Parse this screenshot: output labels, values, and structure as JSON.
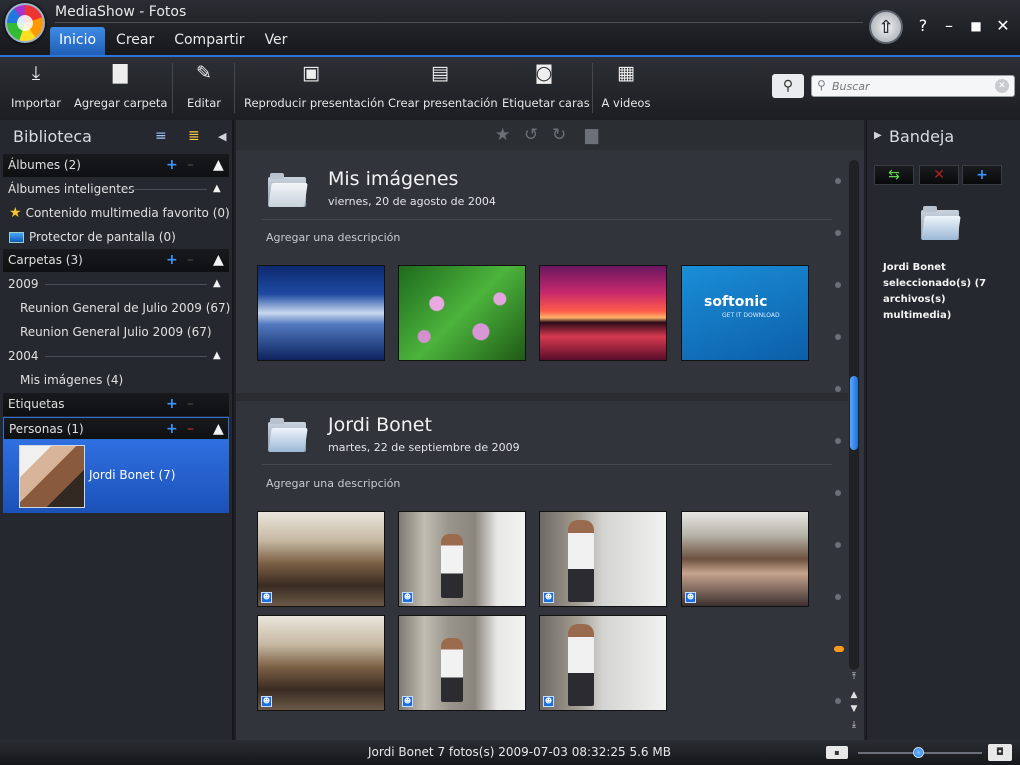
{
  "app": {
    "title": "MediaShow - Fotos"
  },
  "menu": [
    {
      "label": "Inicio",
      "active": true
    },
    {
      "label": "Crear"
    },
    {
      "label": "Compartir"
    },
    {
      "label": "Ver"
    }
  ],
  "window_controls": {
    "help": "?",
    "minimize": "–",
    "maximize": "■",
    "close": "✕"
  },
  "toolbar": {
    "items": [
      {
        "label": "Importar",
        "icon": "import-icon"
      },
      {
        "label": "Agregar carpeta",
        "icon": "add-folder-icon"
      },
      {
        "label": "Editar",
        "icon": "edit-brush-icon"
      },
      {
        "label": "Reproducir presentación",
        "icon": "play-slideshow-icon"
      },
      {
        "label": "Crear presentación",
        "icon": "create-slideshow-icon"
      },
      {
        "label": "Etiquetar caras",
        "icon": "tag-faces-icon"
      },
      {
        "label": "A videos",
        "icon": "to-video-icon"
      }
    ]
  },
  "search": {
    "placeholder": "Buscar",
    "value": ""
  },
  "library": {
    "title": "Biblioteca",
    "albums": {
      "label": "Álbumes (2)"
    },
    "smart_albums": {
      "label": "Álbumes inteligentes",
      "items": [
        {
          "label": "Contenido multimedia favorito (0)",
          "icon": "star-icon"
        },
        {
          "label": "Protector de pantalla (0)",
          "icon": "screensaver-icon"
        }
      ]
    },
    "folders": {
      "label": "Carpetas (3)",
      "years": [
        {
          "year": "2009",
          "items": [
            "Reunion General de Julio 2009 (67)",
            "Reunion General Julio 2009 (67)"
          ]
        },
        {
          "year": "2004",
          "items": [
            "Mis imágenes (4)"
          ]
        }
      ]
    },
    "tags": {
      "label": "Etiquetas"
    },
    "people": {
      "label": "Personas (1)",
      "items": [
        {
          "name": "Jordi Bonet (7)",
          "selected": true
        }
      ]
    }
  },
  "groups": [
    {
      "title": "Mis imágenes",
      "date": "viernes, 20 de agosto de 2004",
      "description_placeholder": "Agregar una descripción",
      "thumbs": [
        "water",
        "lotus",
        "sunset",
        "softonic"
      ],
      "softonic_text": "softonic",
      "softonic_sub": "GET IT DOWNLOAD"
    },
    {
      "title": "Jordi Bonet",
      "date": "martes, 22 de septiembre de 2009",
      "description_placeholder": "Agregar una descripción",
      "thumbs": [
        "room",
        "stage",
        "stage2",
        "crowd",
        "room",
        "stage",
        "stage2"
      ]
    }
  ],
  "tray": {
    "title": "Bandeja",
    "buttons": [
      {
        "icon": "add-to-tray-icon"
      },
      {
        "icon": "remove-icon"
      },
      {
        "icon": "plus-icon"
      }
    ],
    "selection_text": "Jordi Bonet seleccionado(s) (7 archivos(s) multimedia)"
  },
  "status": {
    "text": "Jordi Bonet  7 fotos(s)  2009-07-03 08:32:25  5.6 MB",
    "zoom_level": 0.48
  },
  "colors": {
    "accent": "#2d74d6",
    "selection": "#2360cc",
    "remove": "#e23232"
  }
}
